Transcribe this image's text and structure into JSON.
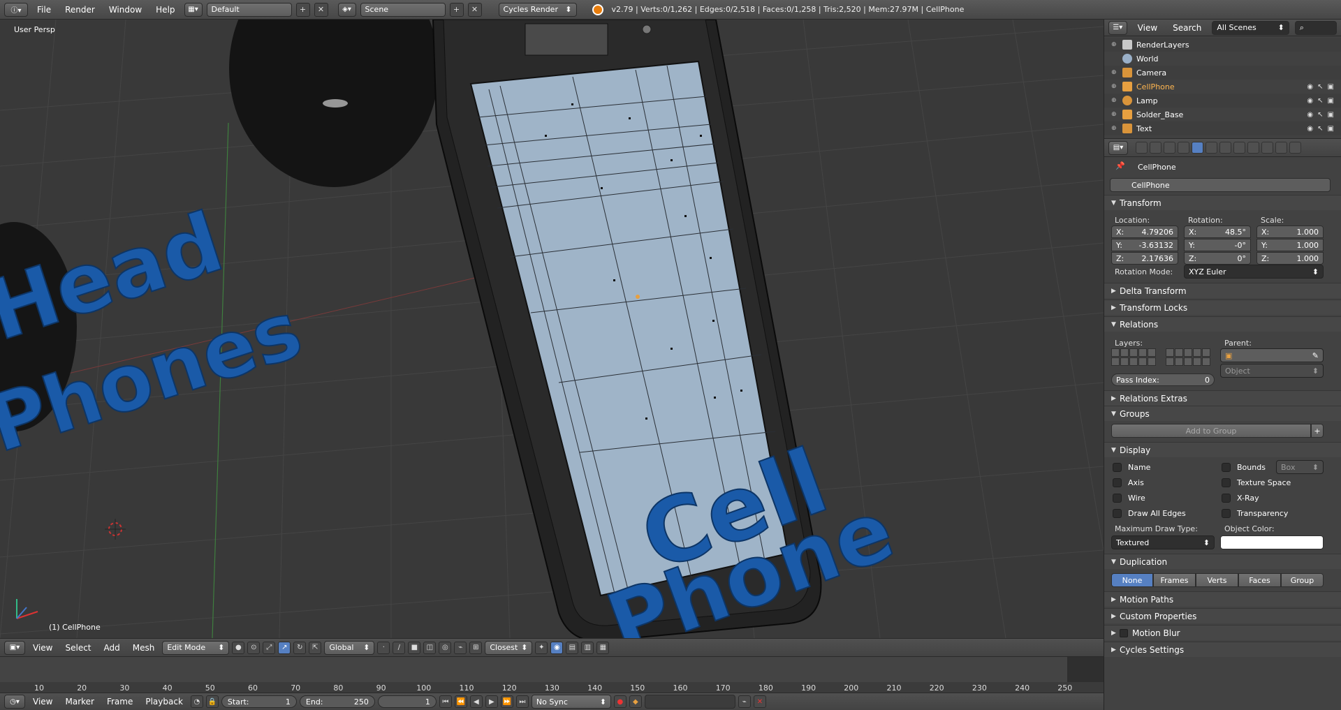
{
  "top_header": {
    "menus": [
      "File",
      "Render",
      "Window",
      "Help"
    ],
    "layout_name": "Default",
    "scene_name": "Scene",
    "render_engine": "Cycles Render",
    "stats": "v2.79 | Verts:0/1,262 | Edges:0/2,518 | Faces:0/1,258 | Tris:2,520 | Mem:27.97M | CellPhone"
  },
  "viewport": {
    "view_label": "User Persp",
    "object_label": "(1) CellPhone",
    "scene_text_1": "Head",
    "scene_text_2": "Phones",
    "scene_text_3": "Cell",
    "scene_text_4": "Phone",
    "text_color": "#1a5aa8"
  },
  "viewport_header": {
    "menus": [
      "View",
      "Select",
      "Add",
      "Mesh"
    ],
    "mode": "Edit Mode",
    "orientation": "Global",
    "snap_target": "Closest"
  },
  "timeline": {
    "ticks": [
      10,
      20,
      30,
      40,
      50,
      60,
      70,
      80,
      90,
      100,
      110,
      120,
      130,
      140,
      150,
      160,
      170,
      180,
      190,
      200,
      210,
      220,
      230,
      240,
      250
    ],
    "menus": [
      "View",
      "Marker",
      "Frame",
      "Playback"
    ],
    "start_label": "Start:",
    "start_value": "1",
    "end_label": "End:",
    "end_value": "250",
    "current_frame": "1",
    "sync": "No Sync"
  },
  "outliner": {
    "menus": [
      "View",
      "Search"
    ],
    "filter": "All Scenes",
    "items": [
      {
        "name": "RenderLayers",
        "icon": "renderlayers-icon",
        "color": "#c8c8c8"
      },
      {
        "name": "World",
        "icon": "world-icon",
        "color": "#9ab0c8"
      },
      {
        "name": "Camera",
        "icon": "camera-icon",
        "color": "#d9943a"
      },
      {
        "name": "CellPhone",
        "icon": "mesh-icon",
        "color": "#e8a040"
      },
      {
        "name": "Lamp",
        "icon": "lamp-icon",
        "color": "#d9943a"
      },
      {
        "name": "Solder_Base",
        "icon": "mesh-icon",
        "color": "#e8a040"
      },
      {
        "name": "Text",
        "icon": "text-icon",
        "color": "#d9943a"
      }
    ]
  },
  "properties": {
    "breadcrumb": "CellPhone",
    "object_name": "CellPhone",
    "transform": {
      "title": "Transform",
      "location_label": "Location:",
      "rotation_label": "Rotation:",
      "scale_label": "Scale:",
      "location": {
        "x": "4.79206",
        "y": "-3.63132",
        "z": "2.17636"
      },
      "rotation": {
        "x": "48.5°",
        "y": "-0°",
        "z": "0°"
      },
      "scale": {
        "x": "1.000",
        "y": "1.000",
        "z": "1.000"
      },
      "rotation_mode_label": "Rotation Mode:",
      "rotation_mode": "XYZ Euler"
    },
    "delta_transform": "Delta Transform",
    "transform_locks": "Transform Locks",
    "relations": {
      "title": "Relations",
      "layers_label": "Layers:",
      "parent_label": "Parent:",
      "parent_type": "Object",
      "pass_index_label": "Pass Index:",
      "pass_index": "0"
    },
    "relations_extras": "Relations Extras",
    "groups": {
      "title": "Groups",
      "add_button": "Add to Group"
    },
    "display": {
      "title": "Display",
      "left_options": [
        "Name",
        "Axis",
        "Wire",
        "Draw All Edges"
      ],
      "right_options": [
        "Bounds",
        "Texture Space",
        "X-Ray",
        "Transparency"
      ],
      "bounds_type": "Box",
      "max_draw_type_label": "Maximum Draw Type:",
      "max_draw_type": "Textured",
      "object_color_label": "Object Color:",
      "object_color": "#ffffff"
    },
    "duplication": {
      "title": "Duplication",
      "options": [
        "None",
        "Frames",
        "Verts",
        "Faces",
        "Group"
      ],
      "active": "None"
    },
    "motion_paths": "Motion Paths",
    "custom_properties": "Custom Properties",
    "motion_blur": "Motion Blur",
    "cycles_settings": "Cycles Settings"
  },
  "colors": {
    "accent": "#5680c2",
    "active_object": "#e8a040"
  }
}
